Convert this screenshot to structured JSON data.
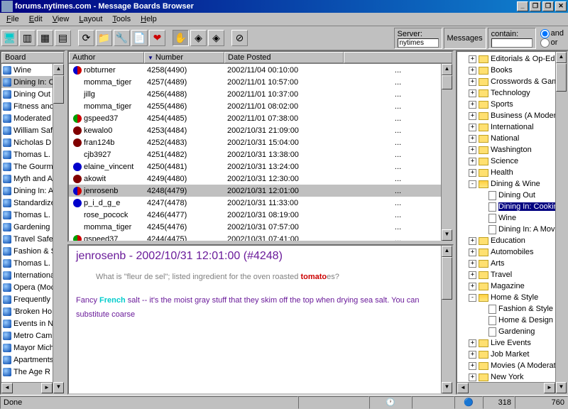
{
  "window": {
    "title": "forums.nytimes.com - Message Boards Browser"
  },
  "menu": [
    "File",
    "Edit",
    "View",
    "Layout",
    "Tools",
    "Help"
  ],
  "menu_accel": [
    "F",
    "E",
    "V",
    "L",
    "T",
    "H"
  ],
  "toolbar_server": {
    "label": "Server:",
    "value": "nytimes"
  },
  "toolbar_msgs": "Messages",
  "toolbar_contain": {
    "label": "contain:",
    "value": "",
    "and": "and",
    "or": "or"
  },
  "cols": {
    "board": "Board",
    "author": "Author",
    "number": "Number",
    "date": "Date Posted"
  },
  "boards": [
    {
      "name": "Wine"
    },
    {
      "name": "Dining In: C",
      "sel": true
    },
    {
      "name": "Dining Out"
    },
    {
      "name": "Fitness anc"
    },
    {
      "name": "Moderated"
    },
    {
      "name": "William Saf"
    },
    {
      "name": "Nicholas D"
    },
    {
      "name": "Thomas L."
    },
    {
      "name": "The Gourm"
    },
    {
      "name": "Myth and A"
    },
    {
      "name": "Dining In: A"
    },
    {
      "name": "Standardize"
    },
    {
      "name": "Thomas L."
    },
    {
      "name": "Gardening"
    },
    {
      "name": "Travel Safe"
    },
    {
      "name": "Fashion & S"
    },
    {
      "name": "Thomas L."
    },
    {
      "name": "Internationa"
    },
    {
      "name": "Opera (Moc"
    },
    {
      "name": "Frequently ."
    },
    {
      "name": "'Broken Ho"
    },
    {
      "name": "Events in N"
    },
    {
      "name": "Metro Camp"
    },
    {
      "name": "Mayor Mich"
    },
    {
      "name": "Apartments"
    },
    {
      "name": "The Age R"
    }
  ],
  "messages": [
    {
      "dot": "halfb",
      "author": "robturner",
      "num": "4258(4490)",
      "date": "2002/11/04 00:10:00",
      "more": "..."
    },
    {
      "dot": "",
      "author": "momma_tiger",
      "num": "4257(4489)",
      "date": "2002/11/01 10:57:00",
      "more": "..."
    },
    {
      "dot": "",
      "author": "jillg",
      "num": "4256(4488)",
      "date": "2002/11/01 10:37:00",
      "more": "..."
    },
    {
      "dot": "",
      "author": "momma_tiger",
      "num": "4255(4486)",
      "date": "2002/11/01 08:02:00",
      "more": "..."
    },
    {
      "dot": "half",
      "author": "gspeed37",
      "num": "4254(4485)",
      "date": "2002/11/01 07:38:00",
      "more": "..."
    },
    {
      "dot": "dred",
      "author": "kewalo0",
      "num": "4253(4484)",
      "date": "2002/10/31 21:09:00",
      "more": "..."
    },
    {
      "dot": "dred",
      "author": "fran124b",
      "num": "4252(4483)",
      "date": "2002/10/31 15:04:00",
      "more": "..."
    },
    {
      "dot": "",
      "author": "cjb3927",
      "num": "4251(4482)",
      "date": "2002/10/31 13:38:00",
      "more": "..."
    },
    {
      "dot": "blue",
      "author": "elaine_vincent",
      "num": "4250(4481)",
      "date": "2002/10/31 13:24:00",
      "more": "..."
    },
    {
      "dot": "dred",
      "author": "akowit",
      "num": "4249(4480)",
      "date": "2002/10/31 12:30:00",
      "more": "..."
    },
    {
      "dot": "halfb",
      "author": "jenrosenb",
      "num": "4248(4479)",
      "date": "2002/10/31 12:01:00",
      "more": "...",
      "sel": true
    },
    {
      "dot": "blue",
      "author": "p_i_d_g_e",
      "num": "4247(4478)",
      "date": "2002/10/31 11:33:00",
      "more": "..."
    },
    {
      "dot": "",
      "author": "rose_pocock",
      "num": "4246(4477)",
      "date": "2002/10/31 08:19:00",
      "more": "..."
    },
    {
      "dot": "",
      "author": "momma_tiger",
      "num": "4245(4476)",
      "date": "2002/10/31 07:57:00",
      "more": "..."
    },
    {
      "dot": "half",
      "author": "gspeed37",
      "num": "4244(4475)",
      "date": "2002/10/31 07:41:00",
      "more": "..."
    }
  ],
  "tree": [
    {
      "lvl": 0,
      "exp": "+",
      "type": "folder",
      "label": "Editorials & Op-Eds"
    },
    {
      "lvl": 0,
      "exp": "+",
      "type": "folder",
      "label": "Books"
    },
    {
      "lvl": 0,
      "exp": "+",
      "type": "folder",
      "label": "Crosswords & Games"
    },
    {
      "lvl": 0,
      "exp": "+",
      "type": "folder",
      "label": "Technology"
    },
    {
      "lvl": 0,
      "exp": "+",
      "type": "folder",
      "label": "Sports"
    },
    {
      "lvl": 0,
      "exp": "+",
      "type": "folder",
      "label": "Business (A Moderate"
    },
    {
      "lvl": 0,
      "exp": "+",
      "type": "folder",
      "label": "International"
    },
    {
      "lvl": 0,
      "exp": "+",
      "type": "folder",
      "label": "National"
    },
    {
      "lvl": 0,
      "exp": "+",
      "type": "folder",
      "label": "Washington"
    },
    {
      "lvl": 0,
      "exp": "+",
      "type": "folder",
      "label": "Science"
    },
    {
      "lvl": 0,
      "exp": "+",
      "type": "folder",
      "label": "Health"
    },
    {
      "lvl": 0,
      "exp": "-",
      "type": "folderopen",
      "label": "Dining & Wine"
    },
    {
      "lvl": 1,
      "exp": "",
      "type": "doc",
      "label": "Dining Out"
    },
    {
      "lvl": 1,
      "exp": "",
      "type": "doc",
      "label": "Dining In: Cooking",
      "sel": true
    },
    {
      "lvl": 1,
      "exp": "",
      "type": "doc",
      "label": "Wine"
    },
    {
      "lvl": 1,
      "exp": "",
      "type": "doc",
      "label": "Dining In: A Move"
    },
    {
      "lvl": 0,
      "exp": "+",
      "type": "folder",
      "label": "Education"
    },
    {
      "lvl": 0,
      "exp": "+",
      "type": "folder",
      "label": "Automobiles"
    },
    {
      "lvl": 0,
      "exp": "+",
      "type": "folder",
      "label": "Arts"
    },
    {
      "lvl": 0,
      "exp": "+",
      "type": "folder",
      "label": "Travel"
    },
    {
      "lvl": 0,
      "exp": "+",
      "type": "folder",
      "label": "Magazine"
    },
    {
      "lvl": 0,
      "exp": "-",
      "type": "folderopen",
      "label": "Home & Style"
    },
    {
      "lvl": 1,
      "exp": "",
      "type": "doc",
      "label": "Fashion & Style"
    },
    {
      "lvl": 1,
      "exp": "",
      "type": "doc",
      "label": "Home & Design"
    },
    {
      "lvl": 1,
      "exp": "",
      "type": "doc",
      "label": "Gardening"
    },
    {
      "lvl": 0,
      "exp": "+",
      "type": "folder",
      "label": "Live Events"
    },
    {
      "lvl": 0,
      "exp": "+",
      "type": "folder",
      "label": "Job Market"
    },
    {
      "lvl": 0,
      "exp": "+",
      "type": "folder",
      "label": "Movies (A Moderated A"
    },
    {
      "lvl": 0,
      "exp": "+",
      "type": "folder",
      "label": "New York"
    }
  ],
  "post": {
    "header": "jenrosenb - 2002/10/31 12:01:00 (#4248)",
    "quote_pre": "What is \"fleur de sel\"; listed ingredient for the oven roasted ",
    "quote_hl": "tomato",
    "quote_post": "es?",
    "body_pre": "Fancy ",
    "body_hl": "French",
    "body_post": " salt -- it's the moist gray stuff that they skim off the top when drying sea salt. You can substitute coarse"
  },
  "status": {
    "done": "Done",
    "n1": "318",
    "n2": "760"
  }
}
